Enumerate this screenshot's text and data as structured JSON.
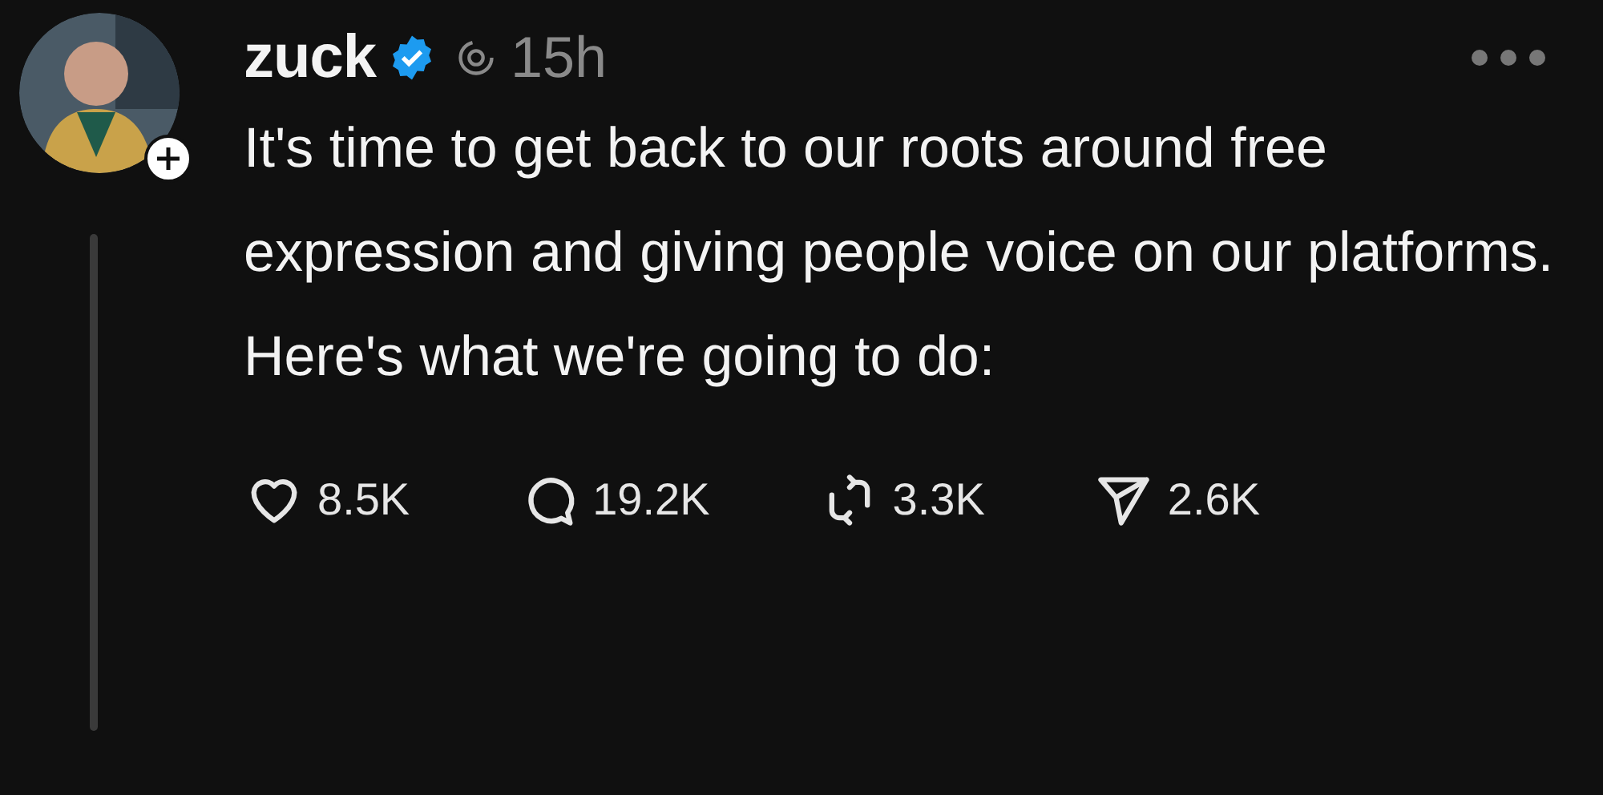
{
  "post": {
    "username": "zuck",
    "verified": true,
    "time": "15h",
    "text": "It's time to get back to our roots around free expression and giving people voice on our platforms. Here's what we're going to do:",
    "actions": [
      {
        "kind": "like",
        "count": "8.5K"
      },
      {
        "kind": "reply",
        "count": "19.2K"
      },
      {
        "kind": "repost",
        "count": "3.3K"
      },
      {
        "kind": "share",
        "count": "2.6K"
      }
    ]
  }
}
